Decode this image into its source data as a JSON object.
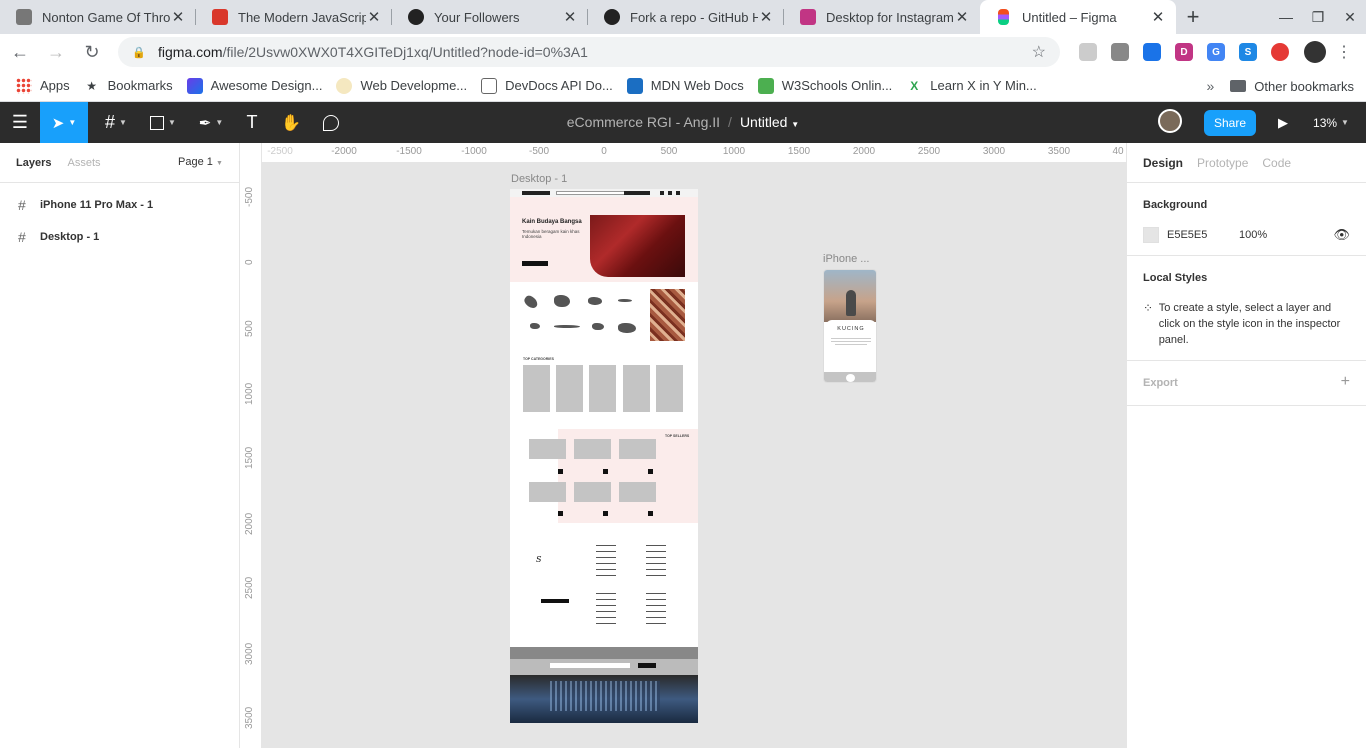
{
  "browser": {
    "tabs": [
      {
        "title": "Nonton Game Of Thron",
        "favicon_color": "#777777",
        "active": false
      },
      {
        "title": "The Modern JavaScrip",
        "favicon_color": "#d9372b",
        "active": false
      },
      {
        "title": "Your Followers",
        "favicon_color": "#222222",
        "active": false
      },
      {
        "title": "Fork a repo - GitHub H",
        "favicon_color": "#222222",
        "active": false
      },
      {
        "title": "Desktop for Instagram",
        "favicon_color": "#c13584",
        "active": false
      },
      {
        "title": "Untitled – Figma",
        "favicon_color": "#f24e1e",
        "active": true
      }
    ],
    "new_tab": "+",
    "window_controls": {
      "minimize": "—",
      "restore": "❐",
      "close": "✕"
    },
    "nav": {
      "back": "←",
      "forward": "→",
      "reload": "↻"
    },
    "url_domain": "figma.com",
    "url_path": "/file/2Usvw0XWX0T4XGITeDj1xq/Untitled?node-id=0%3A1",
    "bookmark_star": "☆",
    "bookmarks": [
      {
        "label": "Apps",
        "icon": "apps-grid-icon"
      },
      {
        "label": "Bookmarks",
        "icon": "star-icon"
      },
      {
        "label": "Awesome Design...",
        "icon": "awesome-design-icon"
      },
      {
        "label": "Web Developme...",
        "icon": "web-dev-icon"
      },
      {
        "label": "DevDocs API Do...",
        "icon": "devdocs-icon"
      },
      {
        "label": "MDN Web Docs",
        "icon": "mdn-icon"
      },
      {
        "label": "W3Schools Onlin...",
        "icon": "w3schools-icon"
      },
      {
        "label": "Learn X in Y Min...",
        "icon": "learnx-icon"
      }
    ],
    "bookmarks_overflow": "»",
    "other_bookmarks": "Other bookmarks"
  },
  "figma": {
    "project": "eCommerce RGI - Ang.II",
    "file_name": "Untitled",
    "share_label": "Share",
    "zoom": "13%",
    "accent": "#18a0fb",
    "left_tabs": {
      "layers": "Layers",
      "assets": "Assets"
    },
    "page_selector": "Page 1",
    "layers": [
      {
        "name": "iPhone 11 Pro Max - 1"
      },
      {
        "name": "Desktop - 1"
      }
    ],
    "ruler_top": [
      "-2500",
      "-2000",
      "-1500",
      "-1000",
      "-500",
      "0",
      "500",
      "1000",
      "1500",
      "2000",
      "2500",
      "3000",
      "3500",
      "40"
    ],
    "ruler_left": [
      "-500",
      "0",
      "500",
      "1000",
      "1500",
      "2000",
      "2500",
      "3000",
      "3500"
    ],
    "frames": {
      "desktop_label": "Desktop - 1",
      "iphone_label": "iPhone ...",
      "hero_title": "Kain Budaya Bangsa",
      "hero_sub": "Temukan beragam kain khas Indonesia",
      "top_categories": "TOP CATEGORIES",
      "top_sellers": "TOP SELLERS",
      "iphone_title": "KUCING"
    },
    "right_tabs": {
      "design": "Design",
      "prototype": "Prototype",
      "code": "Code"
    },
    "background": {
      "title": "Background",
      "hex": "E5E5E5",
      "opacity": "100%",
      "swatch": "#e5e5e5"
    },
    "local_styles": {
      "title": "Local Styles",
      "hint": "To create a style, select a layer and click on the style icon in the inspector panel."
    },
    "export": {
      "title": "Export",
      "add": "+"
    },
    "help": "?"
  }
}
